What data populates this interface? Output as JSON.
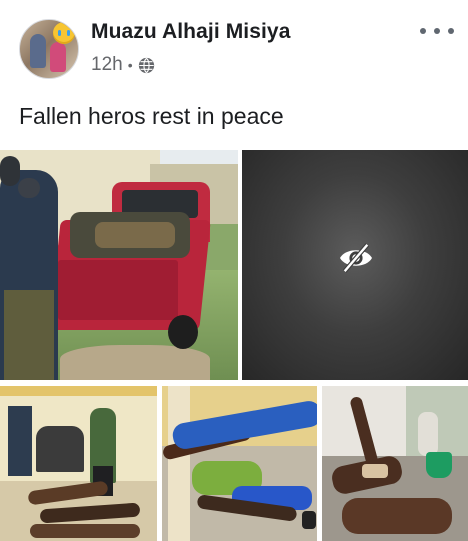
{
  "post": {
    "author_name": "Muazu Alhaji Misiya",
    "time": "12h",
    "separator": "•",
    "privacy_icon": "globe-icon",
    "more_icon": "more-horizontal-icon",
    "text": "Fallen heros rest in peace"
  },
  "photos": {
    "count": 5,
    "hidden_photo_icon": "eye-slash-icon"
  },
  "colors": {
    "author_text": "#1c1e21",
    "meta_text": "#65676b",
    "hidden_overlay": "#3e3e3e"
  }
}
